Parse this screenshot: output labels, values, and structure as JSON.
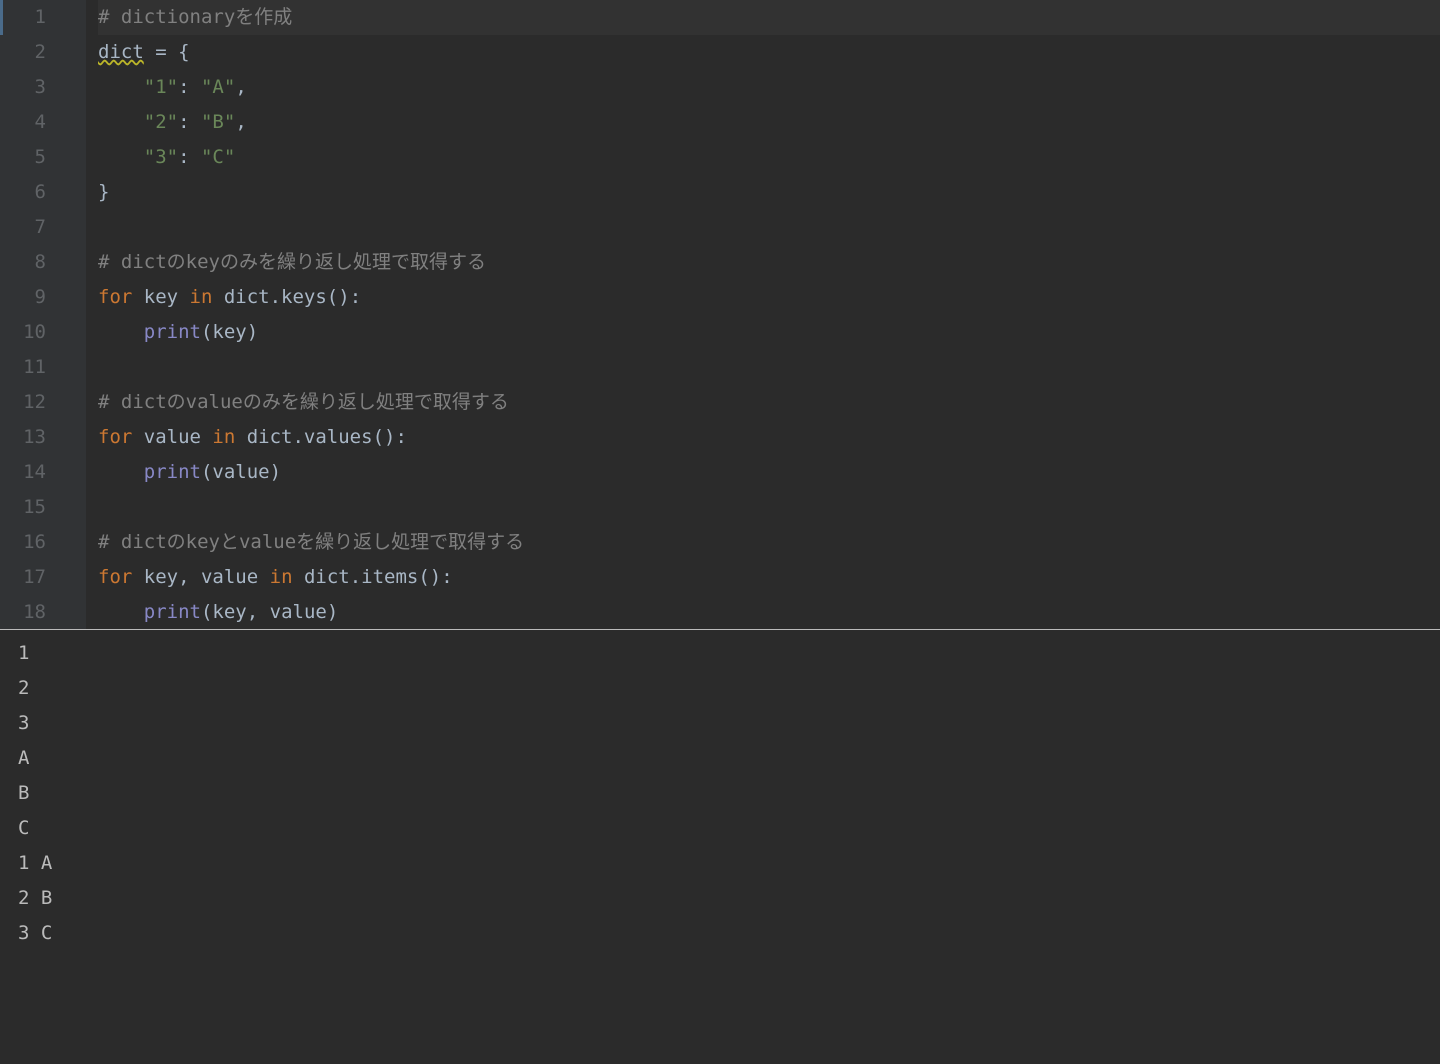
{
  "editor": {
    "lines": [
      {
        "num": "1",
        "tokens": [
          {
            "t": "# dictionaryを作成",
            "c": "c-comment"
          }
        ],
        "caret": true
      },
      {
        "num": "2",
        "tokens": [
          {
            "t": "dict",
            "c": "c-identifier c-warn"
          },
          {
            "t": " = {",
            "c": "c-operator"
          }
        ]
      },
      {
        "num": "3",
        "tokens": [
          {
            "t": "    ",
            "c": ""
          },
          {
            "t": "\"1\"",
            "c": "c-string"
          },
          {
            "t": ": ",
            "c": "c-operator"
          },
          {
            "t": "\"A\"",
            "c": "c-string"
          },
          {
            "t": ",",
            "c": "c-operator"
          }
        ]
      },
      {
        "num": "4",
        "tokens": [
          {
            "t": "    ",
            "c": ""
          },
          {
            "t": "\"2\"",
            "c": "c-string"
          },
          {
            "t": ": ",
            "c": "c-operator"
          },
          {
            "t": "\"B\"",
            "c": "c-string"
          },
          {
            "t": ",",
            "c": "c-operator"
          }
        ]
      },
      {
        "num": "5",
        "tokens": [
          {
            "t": "    ",
            "c": ""
          },
          {
            "t": "\"3\"",
            "c": "c-string"
          },
          {
            "t": ": ",
            "c": "c-operator"
          },
          {
            "t": "\"C\"",
            "c": "c-string"
          }
        ]
      },
      {
        "num": "6",
        "tokens": [
          {
            "t": "}",
            "c": "c-operator"
          }
        ]
      },
      {
        "num": "7",
        "tokens": []
      },
      {
        "num": "8",
        "tokens": [
          {
            "t": "# dictのkeyのみを繰り返し処理で取得する",
            "c": "c-comment"
          }
        ]
      },
      {
        "num": "9",
        "tokens": [
          {
            "t": "for ",
            "c": "c-keyword"
          },
          {
            "t": "key ",
            "c": "c-identifier"
          },
          {
            "t": "in ",
            "c": "c-keyword"
          },
          {
            "t": "dict.keys():",
            "c": "c-identifier"
          }
        ]
      },
      {
        "num": "10",
        "tokens": [
          {
            "t": "    ",
            "c": ""
          },
          {
            "t": "print",
            "c": "c-builtin"
          },
          {
            "t": "(key)",
            "c": "c-identifier"
          }
        ]
      },
      {
        "num": "11",
        "tokens": []
      },
      {
        "num": "12",
        "tokens": [
          {
            "t": "# dictのvalueのみを繰り返し処理で取得する",
            "c": "c-comment"
          }
        ]
      },
      {
        "num": "13",
        "tokens": [
          {
            "t": "for ",
            "c": "c-keyword"
          },
          {
            "t": "value ",
            "c": "c-identifier"
          },
          {
            "t": "in ",
            "c": "c-keyword"
          },
          {
            "t": "dict.values():",
            "c": "c-identifier"
          }
        ]
      },
      {
        "num": "14",
        "tokens": [
          {
            "t": "    ",
            "c": ""
          },
          {
            "t": "print",
            "c": "c-builtin"
          },
          {
            "t": "(value)",
            "c": "c-identifier"
          }
        ]
      },
      {
        "num": "15",
        "tokens": []
      },
      {
        "num": "16",
        "tokens": [
          {
            "t": "# dictのkeyとvalueを繰り返し処理で取得する",
            "c": "c-comment"
          }
        ]
      },
      {
        "num": "17",
        "tokens": [
          {
            "t": "for ",
            "c": "c-keyword"
          },
          {
            "t": "key",
            "c": "c-identifier"
          },
          {
            "t": ",",
            "c": "c-operator"
          },
          {
            "t": " value ",
            "c": "c-identifier"
          },
          {
            "t": "in ",
            "c": "c-keyword"
          },
          {
            "t": "dict.items():",
            "c": "c-identifier"
          }
        ]
      },
      {
        "num": "18",
        "tokens": [
          {
            "t": "    ",
            "c": ""
          },
          {
            "t": "print",
            "c": "c-builtin"
          },
          {
            "t": "(key",
            "c": "c-identifier"
          },
          {
            "t": ",",
            "c": "c-operator"
          },
          {
            "t": " value)",
            "c": "c-identifier"
          }
        ]
      }
    ]
  },
  "output": {
    "lines": [
      "1",
      "2",
      "3",
      "A",
      "B",
      "C",
      "1 A",
      "2 B",
      "3 C"
    ]
  }
}
